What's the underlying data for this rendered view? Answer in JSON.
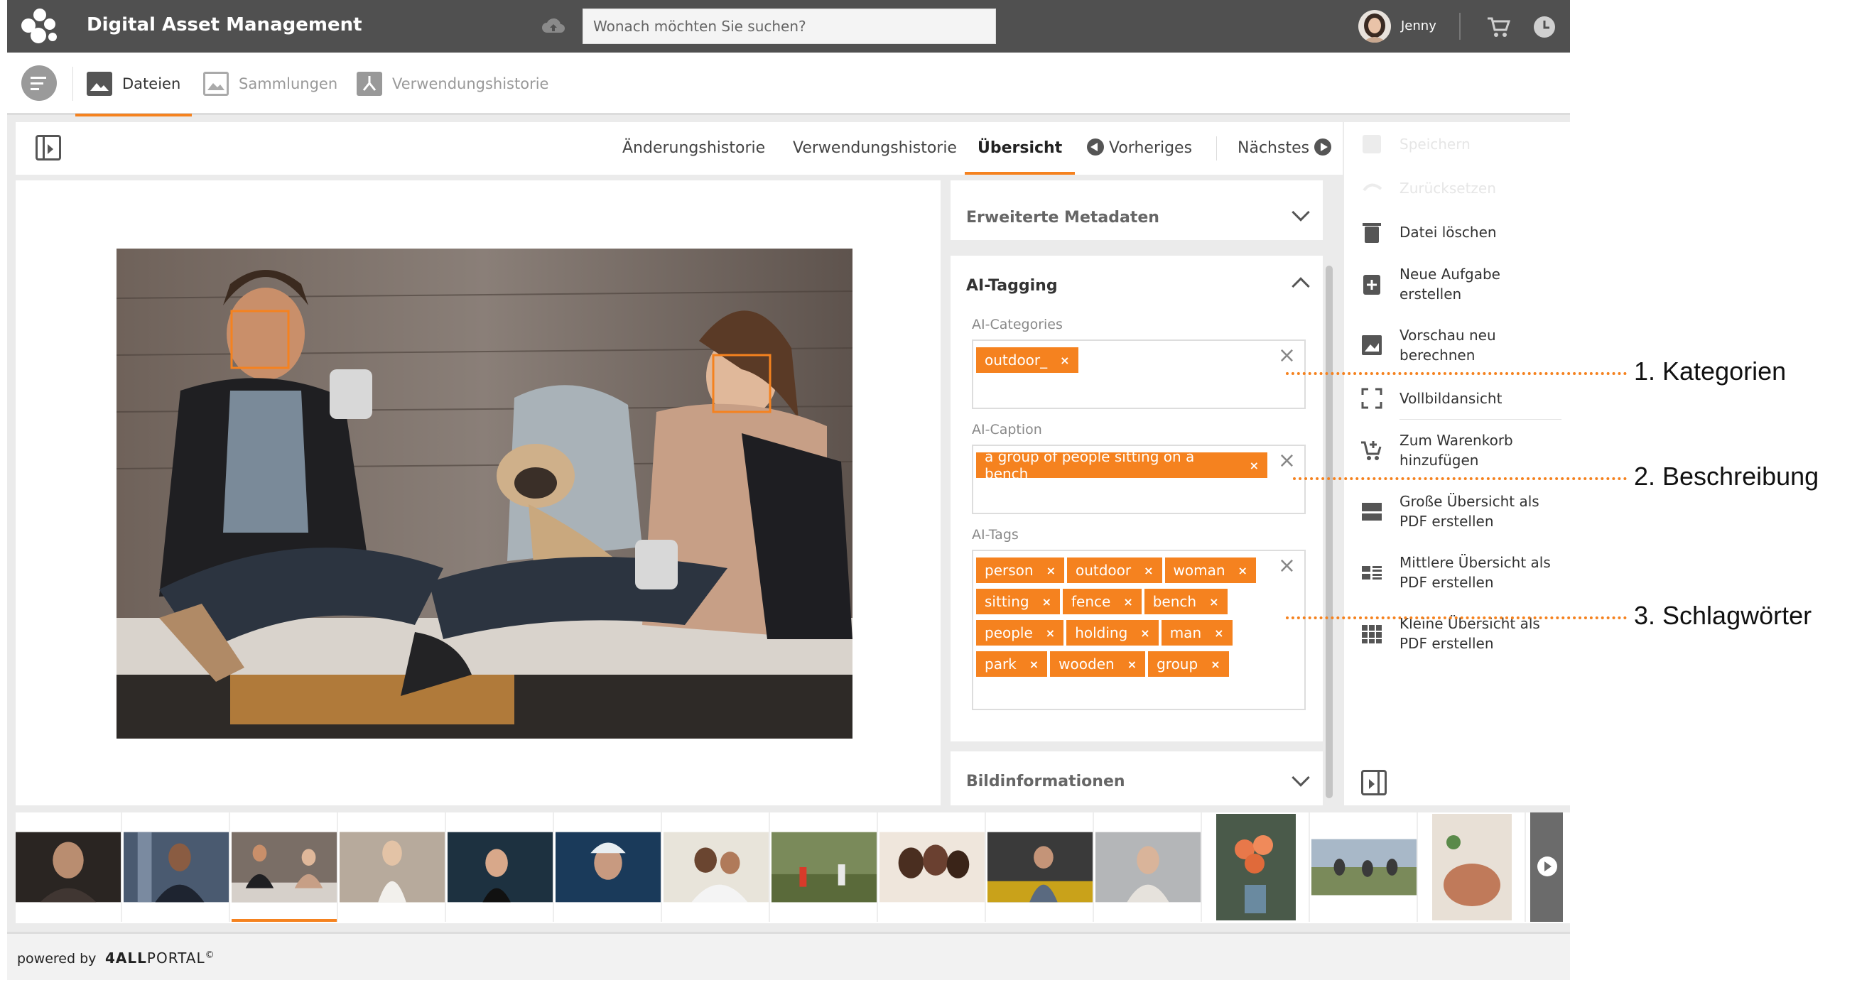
{
  "header": {
    "app_title": "Digital Asset Management",
    "search_placeholder": "Wonach möchten Sie suchen?",
    "user_name": "Jenny"
  },
  "main_nav": {
    "tabs": [
      {
        "label": "Dateien",
        "icon": "image-icon",
        "active": true
      },
      {
        "label": "Sammlungen",
        "icon": "collection-icon",
        "active": false
      },
      {
        "label": "Verwendungshistorie",
        "icon": "usage-history-icon",
        "active": false
      }
    ]
  },
  "content_tabs": {
    "change_history": "Änderungshistorie",
    "usage_history": "Verwendungshistorie",
    "overview": "Übersicht",
    "previous": "Vorheriges",
    "next": "Nächstes"
  },
  "metadata": {
    "extended_title": "Erweiterte Metadaten",
    "ai_title": "AI-Tagging",
    "categories_label": "AI-Categories",
    "categories": [
      "outdoor_"
    ],
    "caption_label": "AI-Caption",
    "caption": [
      "a group of people sitting on a bench"
    ],
    "tags_label": "AI-Tags",
    "tags": [
      "person",
      "outdoor",
      "woman",
      "sitting",
      "fence",
      "bench",
      "people",
      "holding",
      "man",
      "park",
      "wooden",
      "group"
    ],
    "image_info_title": "Bildinformationen",
    "chip_remove": "×",
    "field_clear": "×"
  },
  "actions": {
    "save": "Speichern",
    "reset": "Zurücksetzen",
    "delete": "Datei löschen",
    "new_task": "Neue Aufgabe erstellen",
    "recalc_preview": "Vorschau neu berechnen",
    "fullscreen": "Vollbildansicht",
    "add_to_cart": "Zum Warenkorb hinzufügen",
    "pdf_large": "Große Übersicht als PDF erstellen",
    "pdf_medium": "Mittlere Übersicht als PDF erstellen",
    "pdf_small": "Kleine Übersicht als PDF erstellen"
  },
  "footer": {
    "powered_by": "powered by",
    "brand_bold": "4ALL",
    "brand_rest": "PORTAL",
    "brand_mark": "©"
  },
  "callouts": {
    "categories": "1. Kategorien",
    "caption": "2. Beschreibung",
    "keywords": "3. Schlagwörter"
  },
  "colors": {
    "accent": "#f5821f",
    "topbar": "#505050"
  }
}
